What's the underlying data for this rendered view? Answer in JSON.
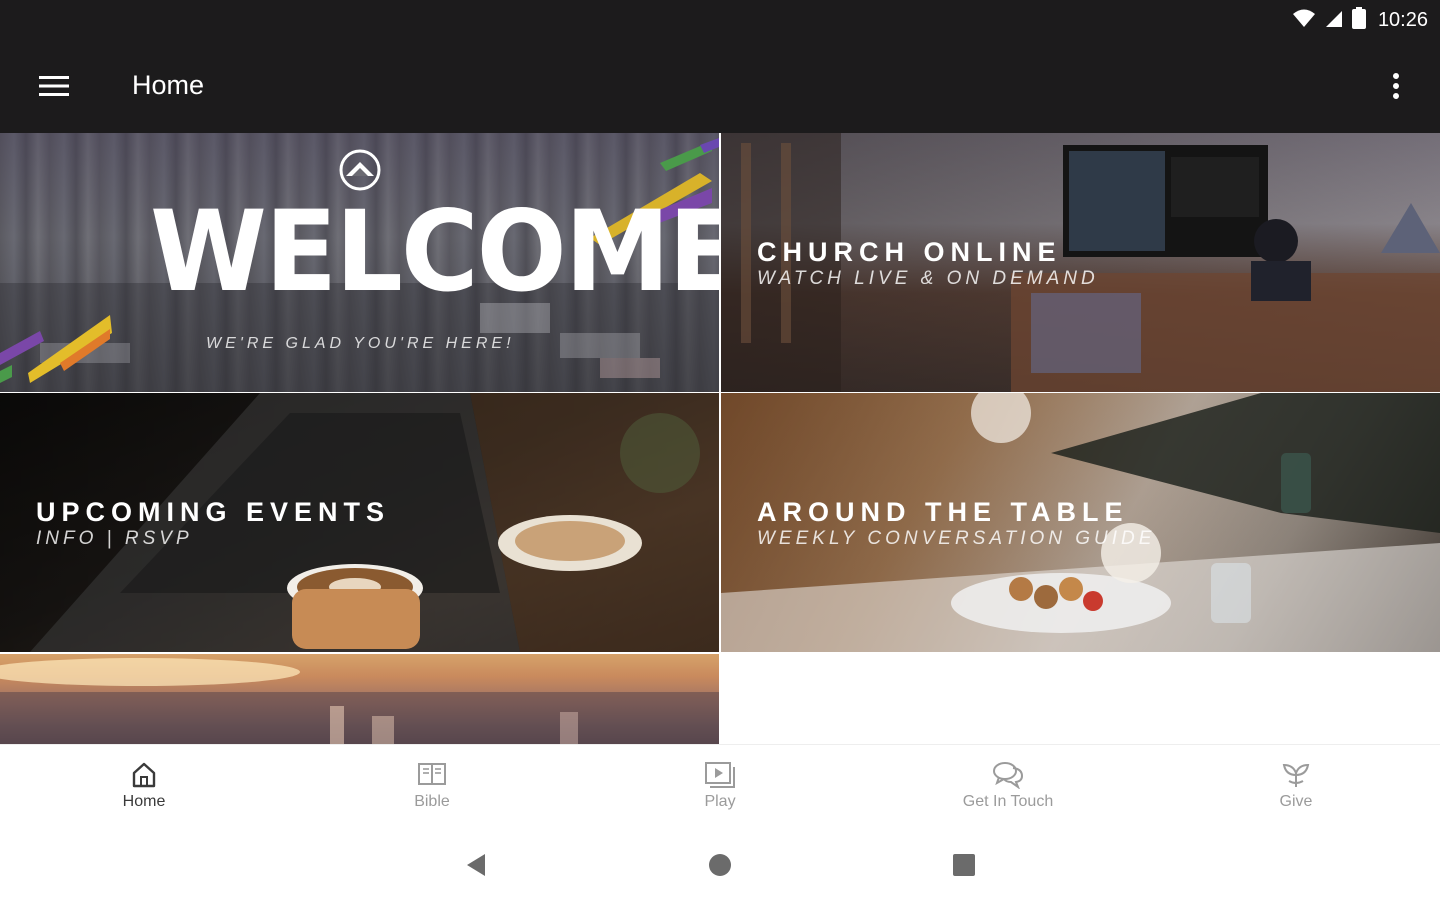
{
  "status_bar": {
    "time": "10:26"
  },
  "app_bar": {
    "title": "Home"
  },
  "tiles": {
    "welcome": {
      "title": "WELCOME",
      "subtitle": "WE'RE GLAD YOU'RE HERE!"
    },
    "church_online": {
      "title": "CHURCH ONLINE",
      "subtitle": "WATCH LIVE & ON DEMAND"
    },
    "upcoming_events": {
      "title": "UPCOMING EVENTS",
      "subtitle": "INFO | RSVP"
    },
    "around_the_table": {
      "title": "AROUND THE TABLE",
      "subtitle": "WEEKLY CONVERSATION GUIDE"
    }
  },
  "bottom_nav": {
    "items": [
      {
        "label": "Home",
        "icon": "home-icon",
        "active": true
      },
      {
        "label": "Bible",
        "icon": "book-icon",
        "active": false
      },
      {
        "label": "Play",
        "icon": "play-icon",
        "active": false
      },
      {
        "label": "Get In Touch",
        "icon": "chat-icon",
        "active": false
      },
      {
        "label": "Give",
        "icon": "plant-icon",
        "active": false
      }
    ]
  },
  "colors": {
    "app_bar": "#1c1b1c",
    "active_nav": "#3a3a3a",
    "inactive_nav": "#9b9b9b"
  }
}
